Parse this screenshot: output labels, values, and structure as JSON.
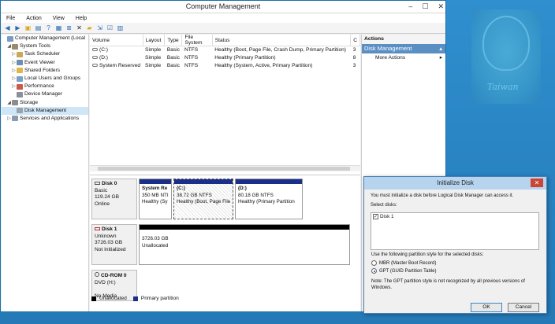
{
  "window": {
    "title": "Computer Management",
    "controls": [
      "–",
      "☐",
      "✕"
    ]
  },
  "menu": [
    "File",
    "Action",
    "View",
    "Help"
  ],
  "toolbar": [
    "back-icon",
    "forward-icon",
    "up-folder-icon",
    "show-tree-icon",
    "help-icon",
    "properties-icon",
    "list-icon",
    "delete-icon",
    "folder-icon",
    "export-icon",
    "checkbox-icon",
    "refresh-icon"
  ],
  "tree": [
    {
      "label": "Computer Management (Local",
      "level": 0,
      "expander": ""
    },
    {
      "label": "System Tools",
      "level": 1,
      "expander": "◢"
    },
    {
      "label": "Task Scheduler",
      "level": 2,
      "expander": "▷"
    },
    {
      "label": "Event Viewer",
      "level": 2,
      "expander": "▷"
    },
    {
      "label": "Shared Folders",
      "level": 2,
      "expander": "▷"
    },
    {
      "label": "Local Users and Groups",
      "level": 2,
      "expander": "▷"
    },
    {
      "label": "Performance",
      "level": 2,
      "expander": "▷"
    },
    {
      "label": "Device Manager",
      "level": 2,
      "expander": ""
    },
    {
      "label": "Storage",
      "level": 1,
      "expander": "◢"
    },
    {
      "label": "Disk Management",
      "level": 2,
      "expander": "",
      "selected": true
    },
    {
      "label": "Services and Applications",
      "level": 1,
      "expander": "▷"
    }
  ],
  "volumes": {
    "headers": [
      "Volume",
      "Layout",
      "Type",
      "File System",
      "Status",
      "C"
    ],
    "rows": [
      [
        "(C:)",
        "Simple",
        "Basic",
        "NTFS",
        "Healthy (Boot, Page File, Crash Dump, Primary Partition)",
        "3"
      ],
      [
        "(D:)",
        "Simple",
        "Basic",
        "NTFS",
        "Healthy (Primary Partition)",
        "8"
      ],
      [
        "System Reserved",
        "Simple",
        "Basic",
        "NTFS",
        "Healthy (System, Active, Primary Partition)",
        "3"
      ]
    ]
  },
  "disks": [
    {
      "name": "Disk 0",
      "lines": [
        "Basic",
        "119.24 GB",
        "Online"
      ],
      "partitions": [
        {
          "title": "System Re",
          "size": "350 MB NTI",
          "status": "Healthy (Sy"
        },
        {
          "title": "(C:)",
          "size": "38.72 GB NTFS",
          "status": "Healthy (Boot, Page File"
        },
        {
          "title": "(D:)",
          "size": "80.18 GB NTFS",
          "status": "Healthy (Primary Partition"
        }
      ]
    },
    {
      "name": "Disk 1",
      "lines": [
        "Unknown",
        "3726.03 GB",
        "Not Initialized"
      ],
      "partitions": [
        {
          "size": "3726.03 GB",
          "status": "Unallocated"
        }
      ]
    },
    {
      "name": "CD-ROM 0",
      "lines": [
        "DVD (H:)",
        "",
        "No Media"
      ],
      "partitions": []
    }
  ],
  "legend": [
    {
      "label": "Unallocated",
      "color": "#000000"
    },
    {
      "label": "Primary partition",
      "color": "#1a2f8a"
    }
  ],
  "actions": {
    "header": "Actions",
    "section": "Disk Management",
    "more": "More Actions"
  },
  "dialog": {
    "title": "Initialize Disk",
    "intro": "You must initialize a disk before Logical Disk Manager can access it.",
    "select_label": "Select disks:",
    "disk_item": "Disk 1",
    "style_label": "Use the following partition style for the selected disks:",
    "mbr": "MBR (Master Boot Record)",
    "gpt": "GPT (GUID Partition Table)",
    "note": "Note: The GPT partition style is not recognized by all previous versions of Windows.",
    "ok": "OK",
    "cancel": "Cancel"
  },
  "wallpaper": {
    "text": "Taiwan"
  }
}
